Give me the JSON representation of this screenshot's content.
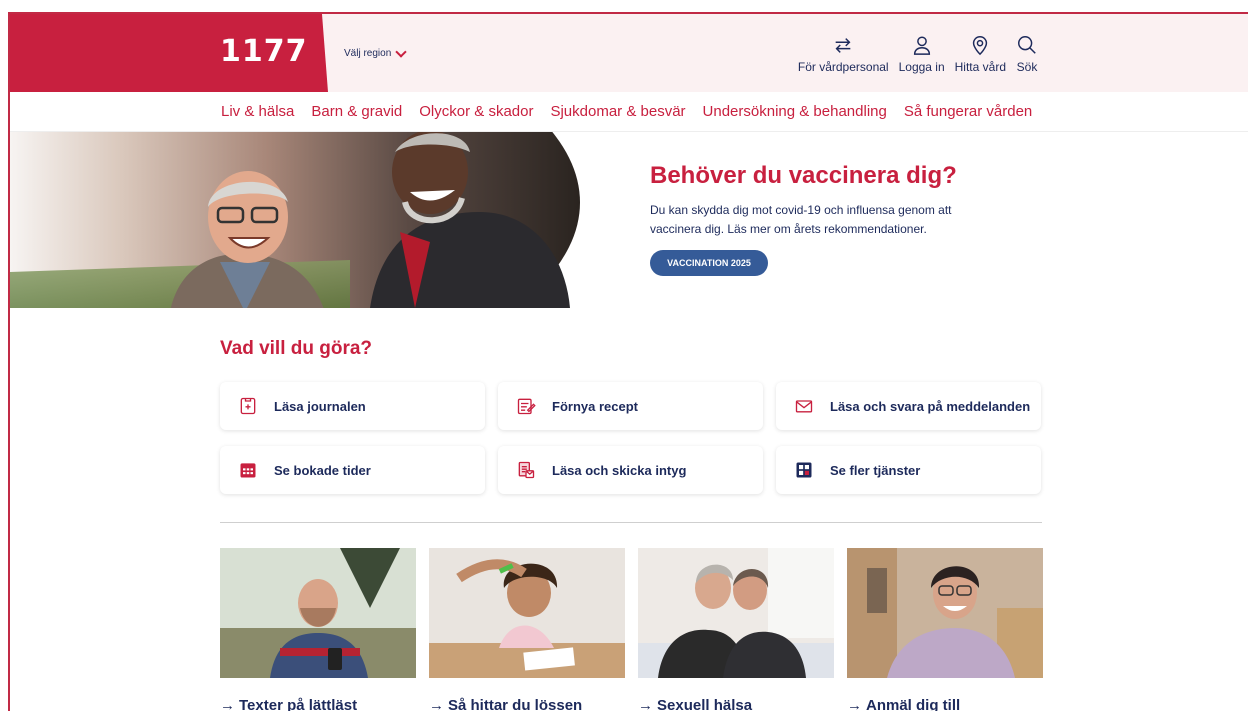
{
  "header": {
    "logo": "1177",
    "region_label": "Välj region",
    "tools": [
      {
        "label": "För vårdpersonal",
        "icon": "swap-arrows-icon"
      },
      {
        "label": "Logga in",
        "icon": "user-icon"
      },
      {
        "label": "Hitta vård",
        "icon": "location-pin-icon"
      },
      {
        "label": "Sök",
        "icon": "search-icon"
      }
    ]
  },
  "nav": {
    "items": [
      "Liv & hälsa",
      "Barn & gravid",
      "Olyckor & skador",
      "Sjukdomar & besvär",
      "Undersökning & behandling",
      "Så fungerar vården"
    ]
  },
  "hero": {
    "title": "Behöver du vaccinera dig?",
    "text": "Du kan skydda dig mot covid-19 och influensa genom att vaccinera dig. Läs mer om årets rekommendationer.",
    "button": "VACCINATION 2025"
  },
  "services": {
    "title": "Vad vill du göra?",
    "items": [
      {
        "label": "Läsa journalen",
        "icon": "journal-icon"
      },
      {
        "label": "Förnya recept",
        "icon": "prescription-icon"
      },
      {
        "label": "Läsa och svara på meddelanden",
        "icon": "mail-icon"
      },
      {
        "label": "Se bokade tider",
        "icon": "calendar-icon"
      },
      {
        "label": "Läsa och skicka intyg",
        "icon": "certificate-icon"
      },
      {
        "label": "Se fler tjänster",
        "icon": "grid-services-icon"
      }
    ]
  },
  "topics": [
    {
      "label": "Texter på lättläst"
    },
    {
      "label": "Så hittar du lössen"
    },
    {
      "label": "Sexuell hälsa"
    },
    {
      "label": "Anmäl dig till"
    }
  ],
  "colors": {
    "brand": "#c8203f",
    "navy": "#1d2a5b",
    "button": "#355b98"
  }
}
